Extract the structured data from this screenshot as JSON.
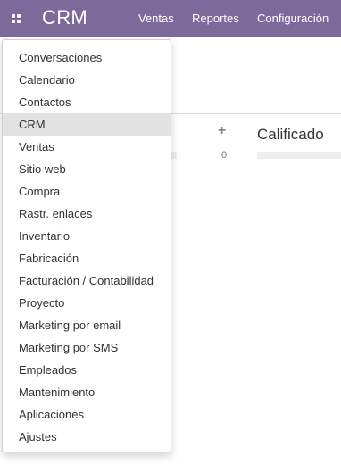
{
  "navbar": {
    "brand": "CRM",
    "items": [
      "Ventas",
      "Reportes",
      "Configuración"
    ]
  },
  "kanban": {
    "stage_title": "Calificado",
    "plus": "+",
    "count": "0"
  },
  "apps_menu": {
    "items": [
      "Conversaciones",
      "Calendario",
      "Contactos",
      "CRM",
      "Ventas",
      "Sitio web",
      "Compra",
      "Rastr. enlaces",
      "Inventario",
      "Fabricación",
      "Facturación / Contabilidad",
      "Proyecto",
      "Marketing por email",
      "Marketing por SMS",
      "Empleados",
      "Mantenimiento",
      "Aplicaciones",
      "Ajustes"
    ],
    "active_index": 3
  },
  "colors": {
    "navbar": "#7c6a9a",
    "active_item": "#e2e2e2"
  }
}
